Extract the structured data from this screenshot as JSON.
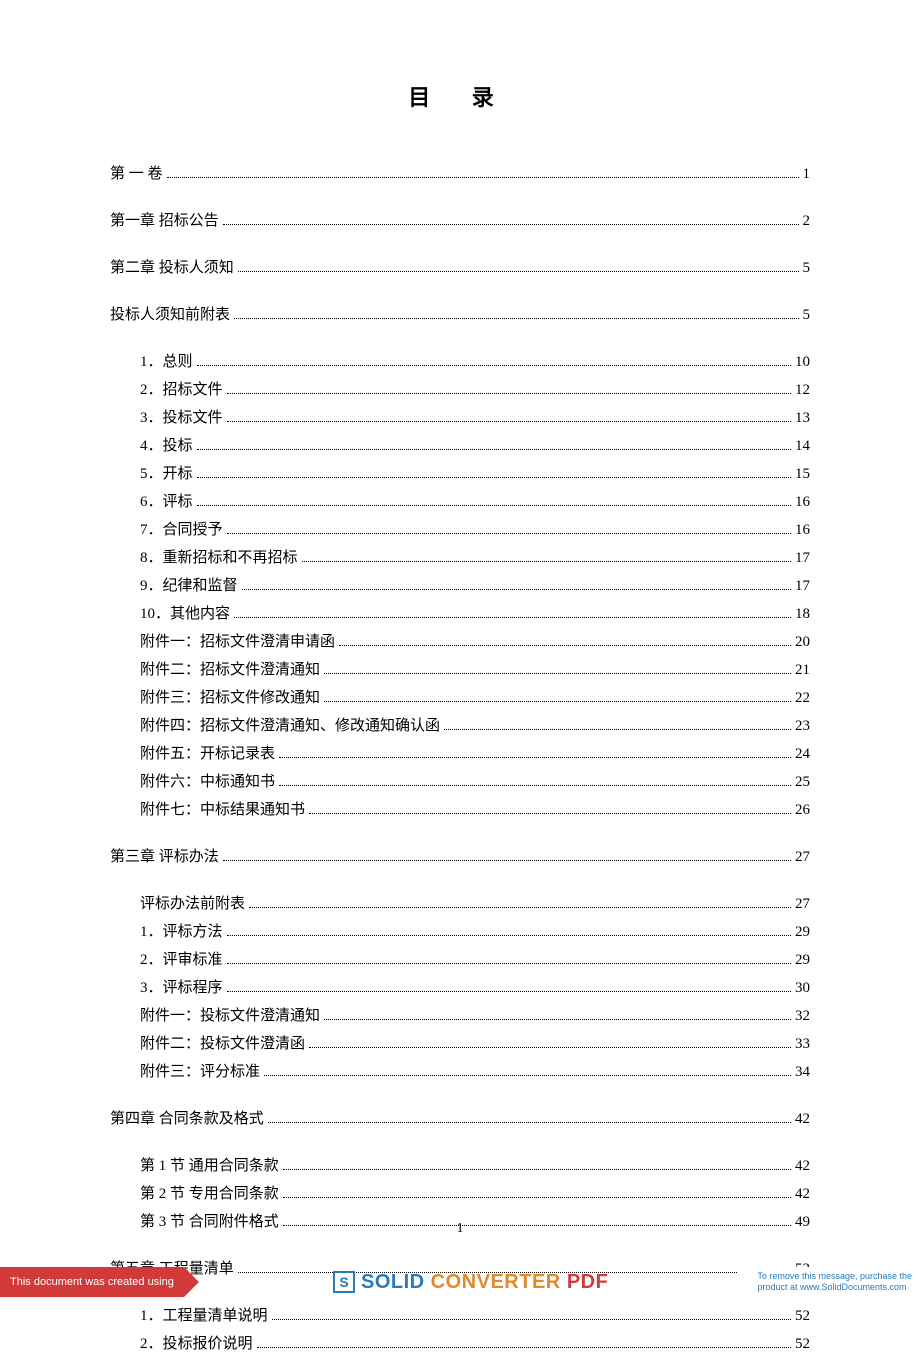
{
  "title": "目   录",
  "page_number": "1",
  "toc": [
    {
      "label": "第 一 卷",
      "page": "1",
      "level": "lvl0-first"
    },
    {
      "label": "第一章   招标公告",
      "page": "2",
      "level": "lvl0"
    },
    {
      "label": "第二章   投标人须知",
      "page": "5",
      "level": "lvl0"
    },
    {
      "label": "投标人须知前附表",
      "page": "5",
      "level": "lvl0"
    },
    {
      "label": "1．总则",
      "page": "10",
      "level": "lvl1"
    },
    {
      "label": "2．招标文件",
      "page": "12",
      "level": "lvl1"
    },
    {
      "label": "3．投标文件",
      "page": "13",
      "level": "lvl1"
    },
    {
      "label": "4．投标",
      "page": "14",
      "level": "lvl1"
    },
    {
      "label": "5．开标",
      "page": "15",
      "level": "lvl1"
    },
    {
      "label": "6．评标",
      "page": "16",
      "level": "lvl1"
    },
    {
      "label": "7．合同授予",
      "page": "16",
      "level": "lvl1"
    },
    {
      "label": "8．重新招标和不再招标",
      "page": "17",
      "level": "lvl1"
    },
    {
      "label": "9．纪律和监督",
      "page": "17",
      "level": "lvl1"
    },
    {
      "label": "10．其他内容",
      "page": "18",
      "level": "lvl1"
    },
    {
      "label": "附件一：招标文件澄清申请函",
      "page": "20",
      "level": "lvl1"
    },
    {
      "label": "附件二：招标文件澄清通知",
      "page": "21",
      "level": "lvl1"
    },
    {
      "label": "附件三：招标文件修改通知",
      "page": "22",
      "level": "lvl1"
    },
    {
      "label": "附件四：招标文件澄清通知、修改通知确认函",
      "page": "23",
      "level": "lvl1"
    },
    {
      "label": "附件五：开标记录表",
      "page": "24",
      "level": "lvl1"
    },
    {
      "label": "附件六：中标通知书",
      "page": "25",
      "level": "lvl1"
    },
    {
      "label": "附件七：中标结果通知书",
      "page": "26",
      "level": "lvl1"
    },
    {
      "label": "第三章   评标办法",
      "page": "27",
      "level": "lvl0"
    },
    {
      "label": "评标办法前附表",
      "page": "27",
      "level": "lvl1"
    },
    {
      "label": "1．评标方法",
      "page": "29",
      "level": "lvl1"
    },
    {
      "label": "2．评审标准",
      "page": "29",
      "level": "lvl1"
    },
    {
      "label": "3．评标程序",
      "page": "30",
      "level": "lvl1"
    },
    {
      "label": "附件一：投标文件澄清通知",
      "page": "32",
      "level": "lvl1"
    },
    {
      "label": "附件二：投标文件澄清函",
      "page": "33",
      "level": "lvl1"
    },
    {
      "label": "附件三：评分标准",
      "page": "34",
      "level": "lvl1"
    },
    {
      "label": "第四章   合同条款及格式",
      "page": "42",
      "level": "lvl0"
    },
    {
      "label": "第 1 节   通用合同条款",
      "page": "42",
      "level": "lvl1b"
    },
    {
      "label": "第 2 节   专用合同条款",
      "page": "42",
      "level": "lvl1b"
    },
    {
      "label": "第 3 节   合同附件格式",
      "page": "49",
      "level": "lvl1b"
    },
    {
      "label": "第五章   工程量清单",
      "page": "52",
      "level": "lvl0"
    },
    {
      "label": "1．工程量清单说明",
      "page": "52",
      "level": "lvl1"
    },
    {
      "label": "2．投标报价说明",
      "page": "52",
      "level": "lvl1"
    }
  ],
  "footer": {
    "left": "This document was created using",
    "brand_solid": "SOLID",
    "brand_converter": "CONVERTER",
    "brand_pdf": "PDF",
    "right_line1": "To remove this message, purchase the",
    "right_line2": "product at www.SolidDocuments.com"
  }
}
